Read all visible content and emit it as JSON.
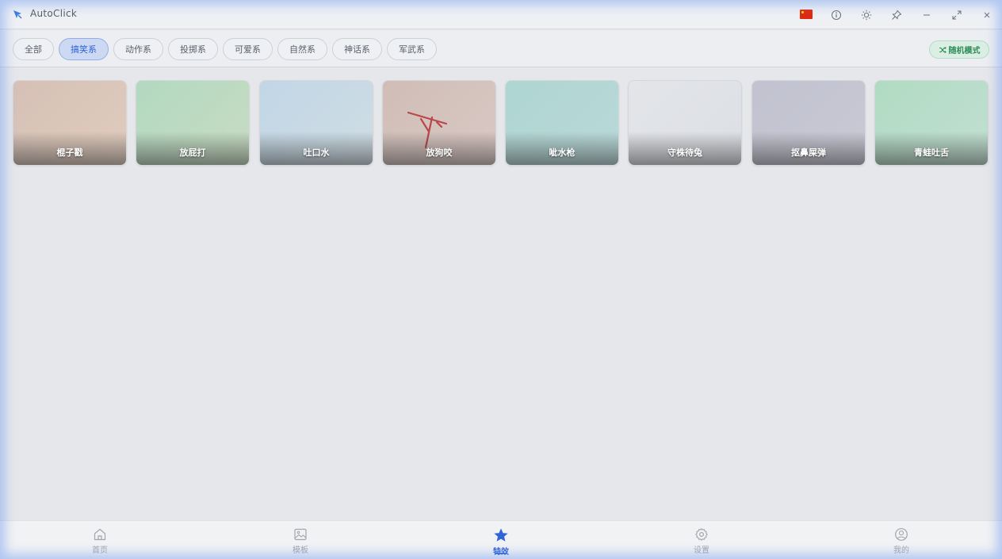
{
  "app": {
    "title": "AutoClick"
  },
  "titlebar": {
    "icons": [
      "flag-cn-icon",
      "info-icon",
      "theme-icon",
      "pin-icon",
      "minimize-icon",
      "maximize-icon",
      "close-icon"
    ]
  },
  "categories": [
    {
      "label": "全部",
      "active": false
    },
    {
      "label": "搞笑系",
      "active": true
    },
    {
      "label": "动作系",
      "active": false
    },
    {
      "label": "投掷系",
      "active": false
    },
    {
      "label": "可爱系",
      "active": false
    },
    {
      "label": "自然系",
      "active": false
    },
    {
      "label": "神话系",
      "active": false
    },
    {
      "label": "军武系",
      "active": false
    }
  ],
  "random_mode": {
    "label": "随机模式",
    "icon": "shuffle-icon"
  },
  "effects": [
    {
      "label": "棍子戳",
      "color": "#d8c2b6"
    },
    {
      "label": "放屁打",
      "color": "#b9d8c6"
    },
    {
      "label": "吐口水",
      "color": "#c6d7e3"
    },
    {
      "label": "放狗咬",
      "color": "#d2bfba"
    },
    {
      "label": "呲水枪",
      "color": "#b3d4d4"
    },
    {
      "label": "守株待兔",
      "color": "#e0e2e6"
    },
    {
      "label": "抠鼻屎弹",
      "color": "#c4c5d1"
    },
    {
      "label": "青蛙吐舌",
      "color": "#bcdcca"
    }
  ],
  "bottom_nav": [
    {
      "label": "首页",
      "icon": "home-icon",
      "active": false
    },
    {
      "label": "模板",
      "icon": "image-icon",
      "active": false
    },
    {
      "label": "特效",
      "icon": "star-icon",
      "active": true
    },
    {
      "label": "设置",
      "icon": "gear-icon",
      "active": false
    },
    {
      "label": "我的",
      "icon": "user-icon",
      "active": false
    }
  ],
  "colors": {
    "accent": "#2f63d6",
    "random_green": "#2e8c56"
  }
}
